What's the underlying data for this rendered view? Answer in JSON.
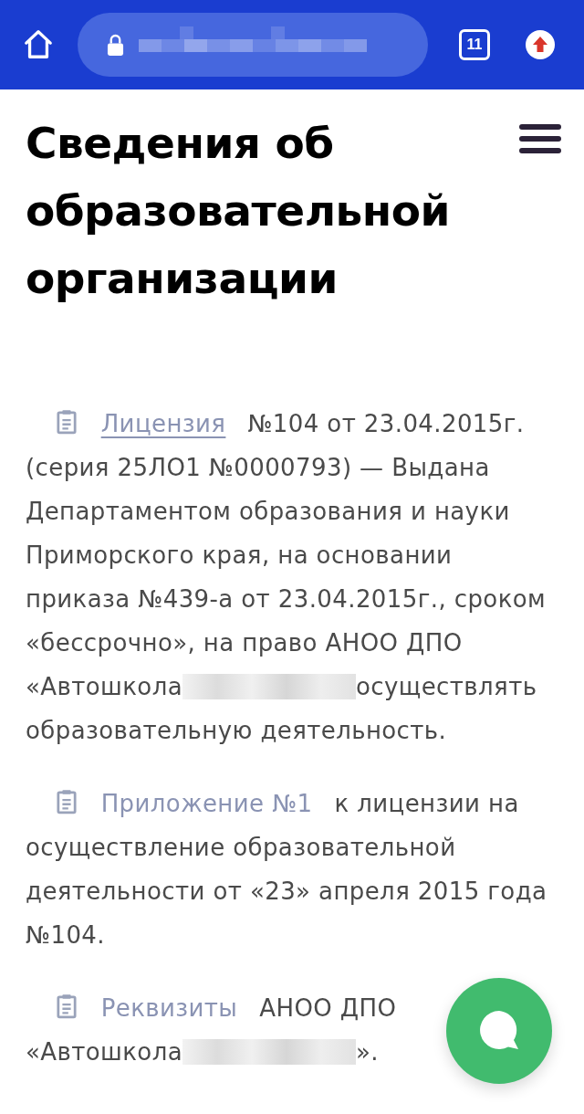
{
  "browser_bar": {
    "tab_count": "11"
  },
  "page": {
    "title": "Сведения об образовательной организации",
    "entries": [
      {
        "link": "Лицензия",
        "underlined": true,
        "text": [
          "№104 от 23.04.2015г. (серия 25ЛО1 №0000793) — Выдана Департаментом образования и науки Приморского края, на основании приказа №439-а от 23.04.2015г., сроком «бессрочно», на право АНОО ДПО «Автошкола",
          "осуществлять образовательную деятельность."
        ]
      },
      {
        "link": "Приложение №1",
        "underlined": false,
        "text": [
          "к лицензии на осуществление образовательной деятельности от «23» апреля 2015 года №104."
        ]
      },
      {
        "link": "Реквизиты",
        "underlined": false,
        "text": [
          "АНОО ДПО «Автошкола",
          "»."
        ]
      }
    ]
  }
}
